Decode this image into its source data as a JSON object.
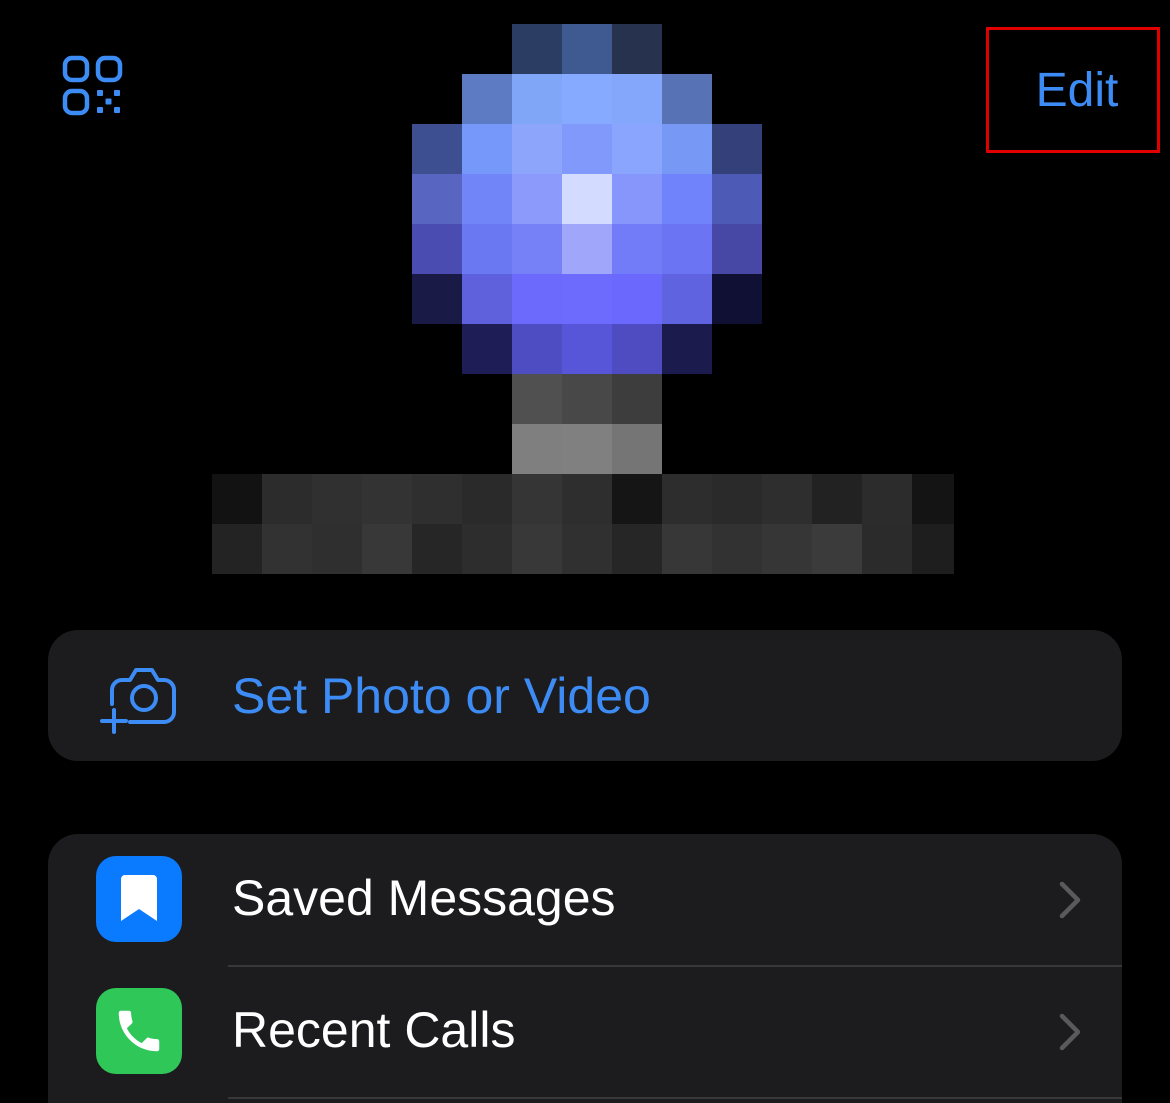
{
  "header": {
    "qr_icon": "qr-code-icon",
    "edit_label": "Edit"
  },
  "profile": {
    "avatar": "pixelated-profile-avatar",
    "name_redacted": true
  },
  "photo_action": {
    "icon": "camera-add-icon",
    "label": "Set Photo or Video"
  },
  "menu": {
    "items": [
      {
        "label": "Saved Messages",
        "icon": "bookmark-icon",
        "icon_bg": "#0a7aff"
      },
      {
        "label": "Recent Calls",
        "icon": "phone-icon",
        "icon_bg": "#30c759"
      }
    ]
  },
  "colors": {
    "accent": "#3d8cf5",
    "card_bg": "#1c1c1e",
    "highlight_border": "#e00000"
  }
}
